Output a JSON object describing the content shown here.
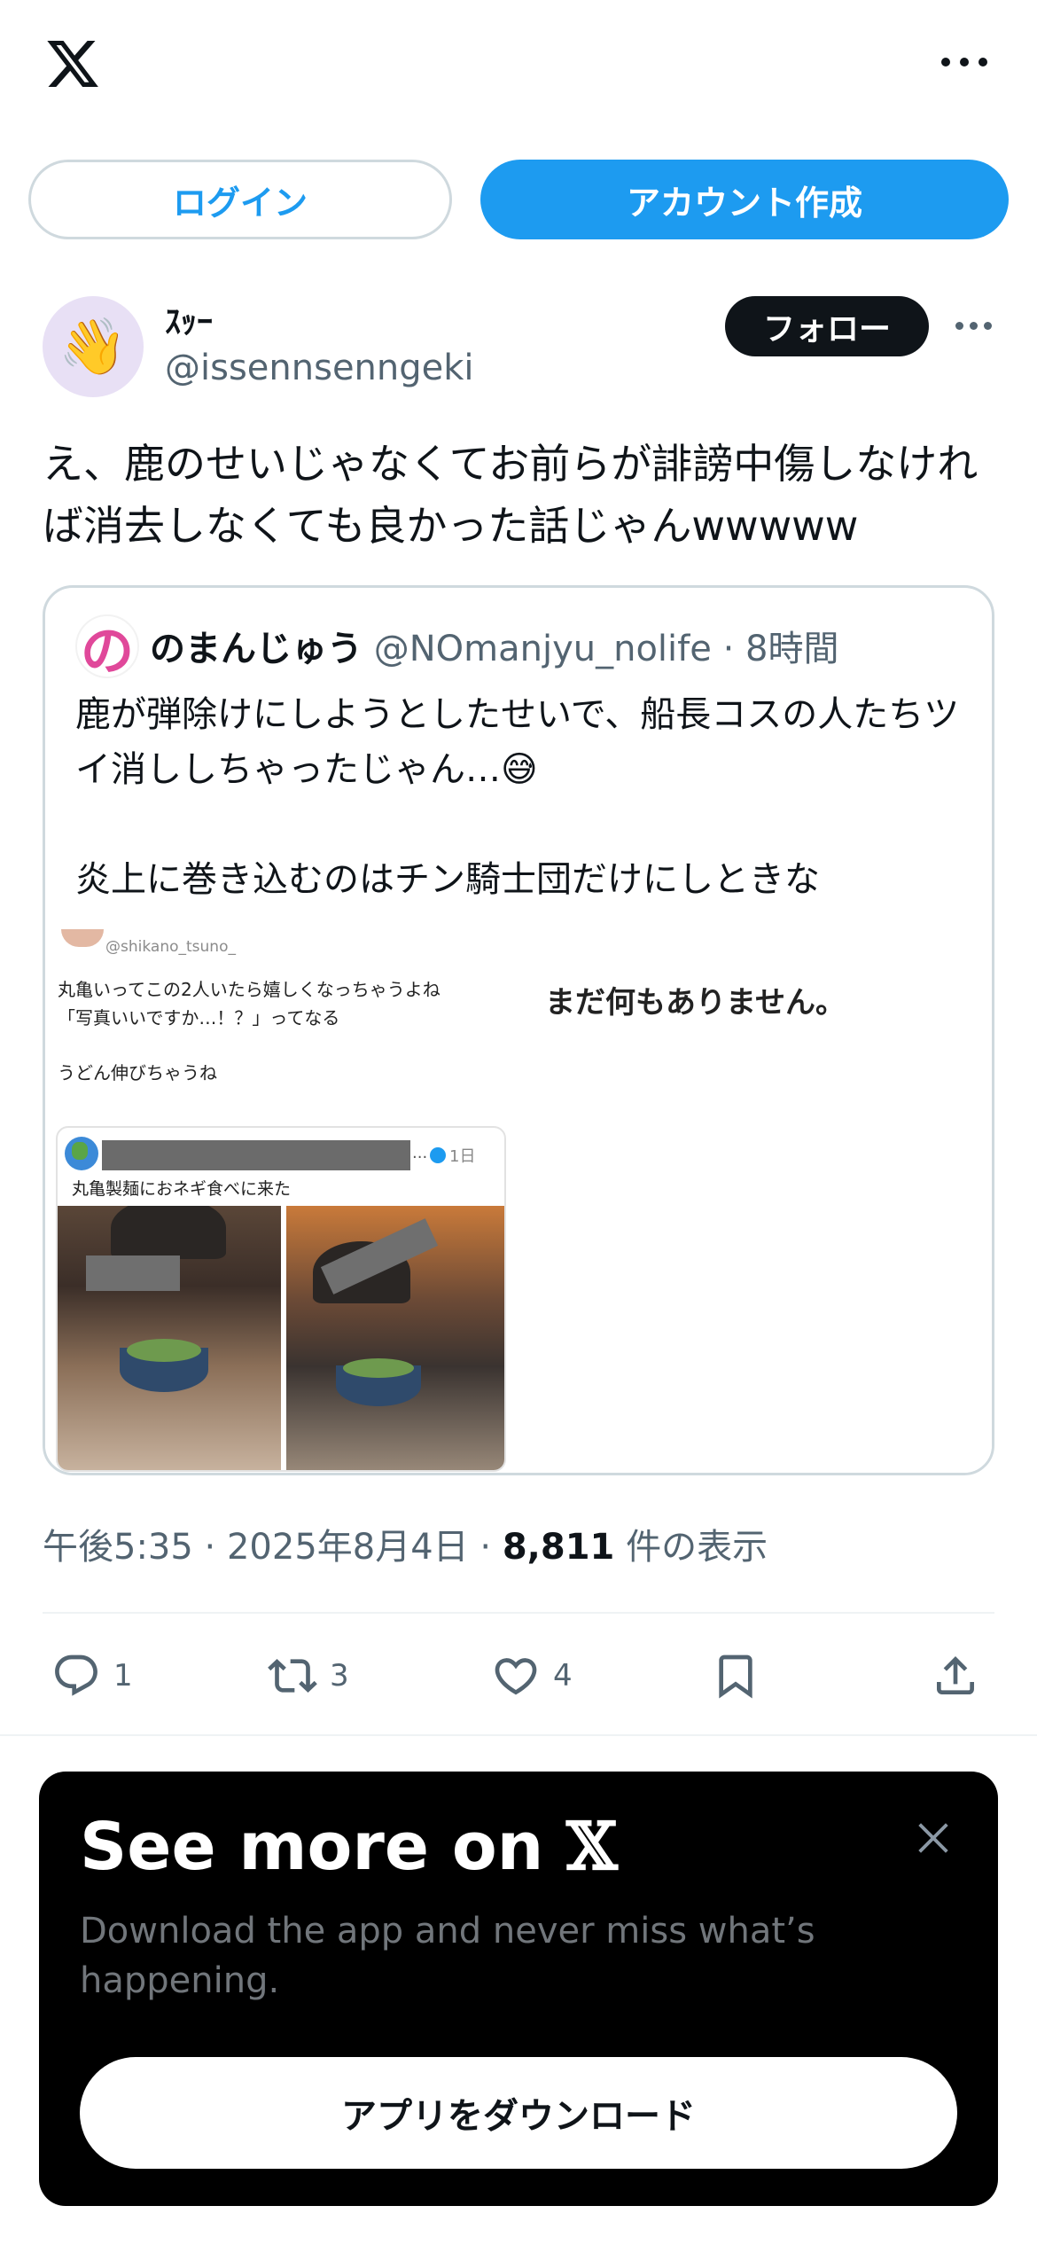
{
  "header": {
    "logo_icon": "x-logo-icon",
    "more_icon": "more-horizontal-icon"
  },
  "auth": {
    "login_label": "ログイン",
    "signup_label": "アカウント作成"
  },
  "tweet": {
    "avatar_emoji": "👋",
    "display_name": "ｽｯｰ",
    "handle": "@issennsenngeki",
    "follow_label": "フォロー",
    "text": "え、鹿のせいじゃなくてお前らが誹謗中傷しなければ消去しなくても良かった話じゃんwwwww",
    "time": "午後5:35",
    "date": "2025年8月4日",
    "views_count": "8,811",
    "views_label": "件の表示",
    "meta_sep": "·"
  },
  "quote": {
    "avatar_glyph": "の",
    "display_name": "のまんじゅう",
    "handle": "@NOmanjyu_nolife",
    "sep": "·",
    "time": "8時間",
    "text_line1": "鹿が弾除けにしようとしたせいで、船長コスの人たちツイ消ししちゃったじゃん…",
    "emoji": "😅",
    "text_line2": "炎上に巻き込むのはチン騎士団だけにしときな",
    "image": {
      "handle": "@shikano_tsuno_",
      "line1": "丸亀いってこの2人いたら嬉しくなっちゃうよね",
      "line2": "「写真いいですか…！？」ってなる",
      "line3": "うどん伸びちゃうね",
      "empty_notice": "まだ何もありません。",
      "inner_time": "1日",
      "inner_dots": "...",
      "inner_caption": "丸亀製麺におネギ食べに来た"
    }
  },
  "actions": {
    "reply_count": "1",
    "retweet_count": "3",
    "like_count": "4"
  },
  "sheet": {
    "title": "See more on",
    "title_x": "𝕏",
    "subtitle": "Download the app and never miss what’s happening.",
    "download_label": "アプリをダウンロード"
  },
  "colors": {
    "accent": "#1d9bf0",
    "text": "#0f1419",
    "muted": "#536471",
    "border": "#cfd9de"
  }
}
